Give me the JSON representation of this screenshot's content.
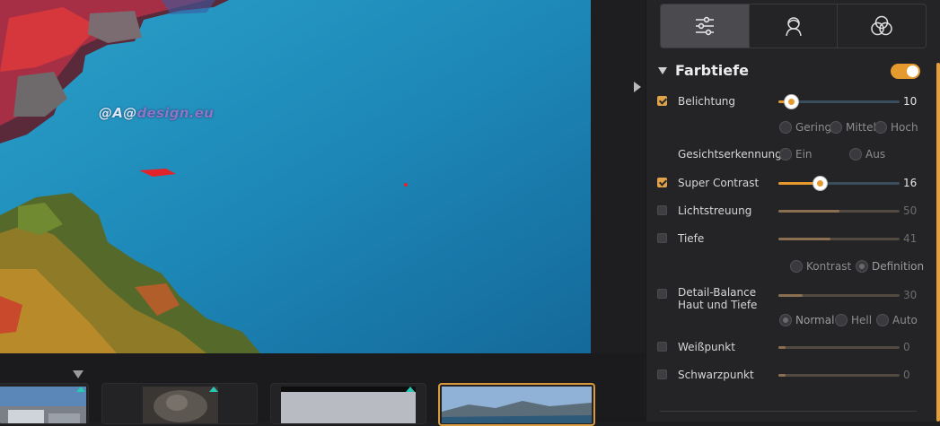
{
  "photo": {
    "watermark_prefix": "@A@",
    "watermark_suffix": "design.eu"
  },
  "filmstrip": {
    "thumbnails": [
      {
        "name": "thumbnail-1",
        "selected": false
      },
      {
        "name": "thumbnail-2",
        "selected": false
      },
      {
        "name": "thumbnail-3",
        "selected": false
      },
      {
        "name": "thumbnail-4",
        "selected": true
      }
    ]
  },
  "panel": {
    "mode_tabs": [
      {
        "icon": "sliders-icon",
        "active": true
      },
      {
        "icon": "portrait-icon",
        "active": false
      },
      {
        "icon": "color-circles-icon",
        "active": false
      }
    ],
    "section": {
      "title": "Farbtiefe",
      "enabled": true
    },
    "controls": {
      "belichtung": {
        "label": "Belichtung",
        "checked": true,
        "value": "10",
        "level": 0.1
      },
      "belichtung_options": [
        "Gering",
        "Mittel",
        "Hoch"
      ],
      "gesicht": {
        "label": "Gesichtserkennung",
        "options": [
          "Ein",
          "Aus"
        ]
      },
      "super_contrast": {
        "label": "Super Contrast",
        "checked": true,
        "value": "16",
        "level": 0.34
      },
      "lichtstreuung": {
        "label": "Lichtstreuung",
        "checked": false,
        "value": "50",
        "level": 0.5
      },
      "tiefe": {
        "label": "Tiefe",
        "checked": false,
        "value": "41",
        "level": 0.43
      },
      "tiefe_options": [
        "Kontrast",
        "Definition"
      ],
      "detail_balance": {
        "label_line1": "Detail-Balance",
        "label_line2": "Haut und Tiefe",
        "checked": false,
        "value": "30",
        "level": 0.2
      },
      "detail_options": [
        "Normal",
        "Hell",
        "Auto"
      ],
      "weisspunkt": {
        "label": "Weißpunkt",
        "checked": false,
        "value": "0",
        "level": 0.06
      },
      "schwarzpunkt": {
        "label": "Schwarzpunkt",
        "checked": false,
        "value": "0",
        "level": 0.06
      }
    }
  },
  "colors": {
    "accent": "#e59a2f",
    "panel_bg": "#242427",
    "thumb_flag": "#27c9b3"
  }
}
